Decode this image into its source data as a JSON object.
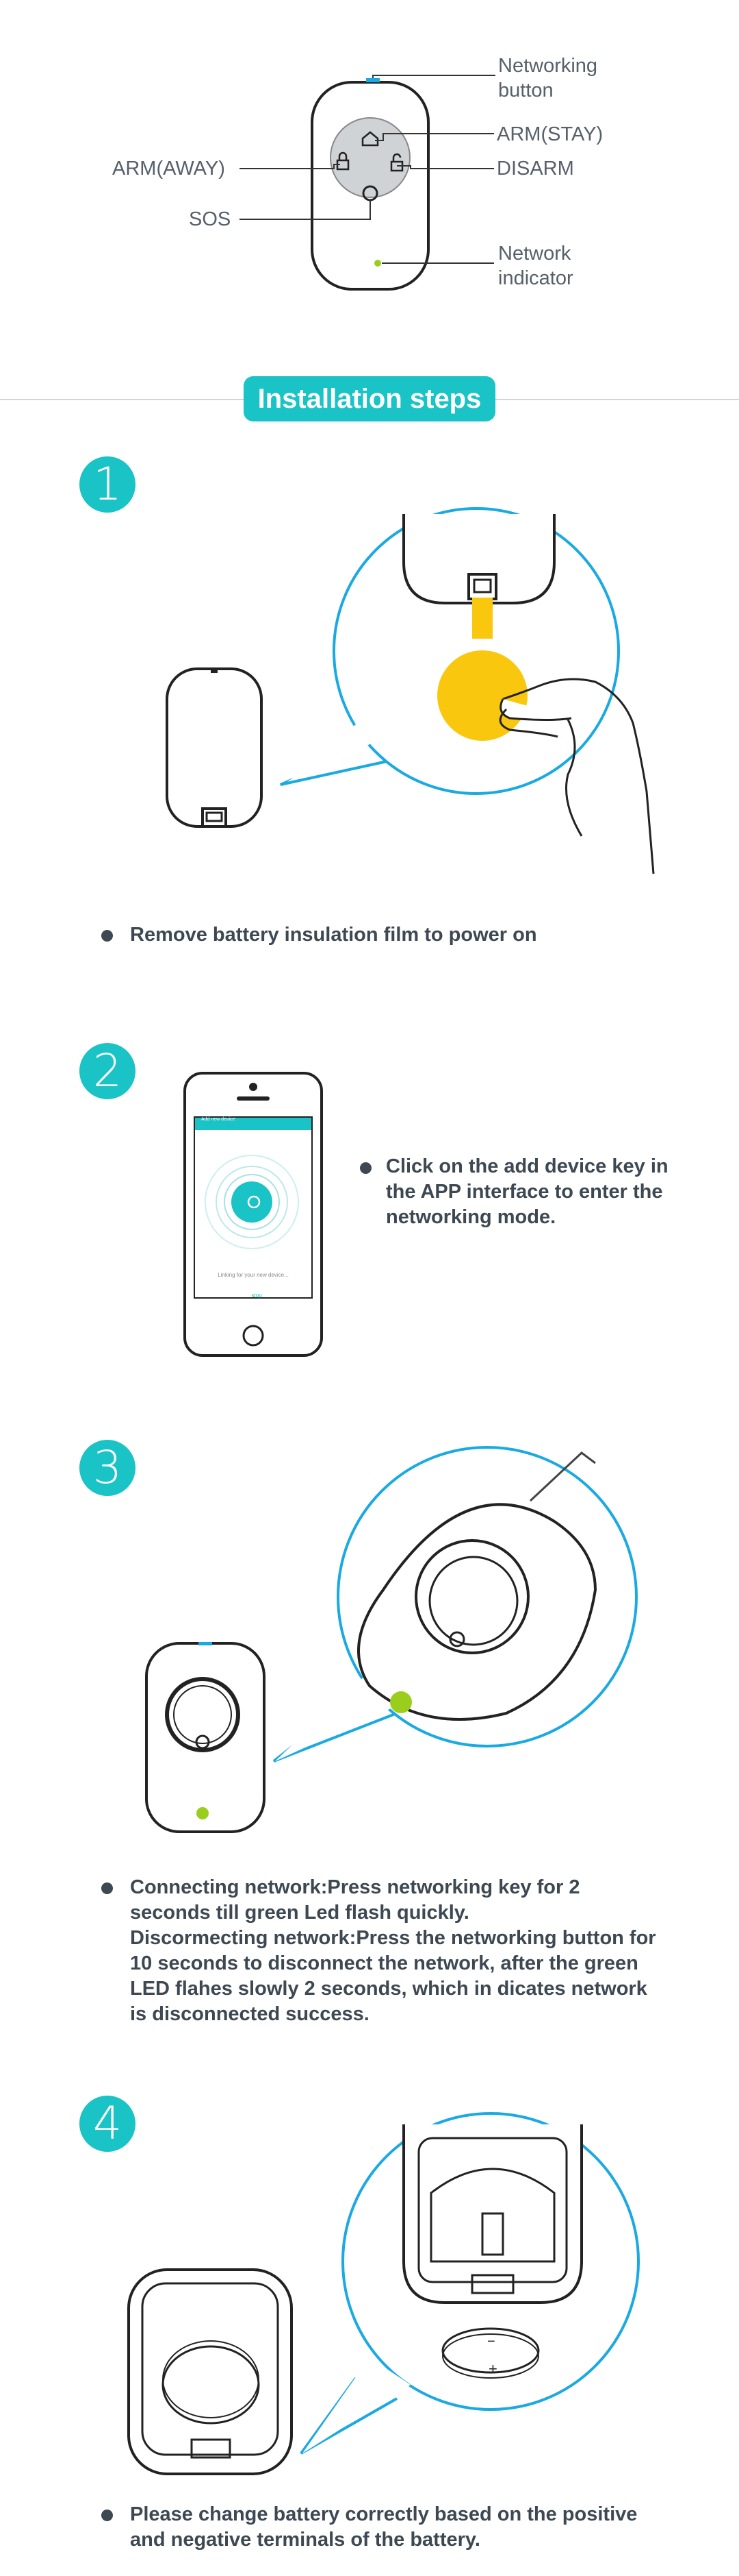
{
  "diagram": {
    "labels": {
      "networking_button": "Networking\nbutton",
      "arm_stay": "ARM(STAY)",
      "arm_away": "ARM(AWAY)",
      "disarm": "DISARM",
      "sos": "SOS",
      "network_indicator": "Network\nindicator"
    }
  },
  "section": {
    "title": "Installation steps"
  },
  "steps": [
    {
      "number": "1",
      "text": "Remove battery insulation film to power on"
    },
    {
      "number": "2",
      "text": "Click on the add device key in the APP interface to enter the networking mode."
    },
    {
      "number": "3",
      "text": "Connecting network:Press networking key for 2 seconds till green Led flash quickly.\nDiscormecting network:Press the networking button for 10 seconds to disconnect the network, after the green LED flahes slowly 2 seconds, which in dicates network is disconnected success."
    },
    {
      "number": "4",
      "text": "Please change battery correctly based on the positive and negative terminals of the battery."
    }
  ],
  "phone": {
    "header": "Add new device",
    "caption": "Linking for your new device...",
    "button": "stop"
  },
  "battery": {
    "minus": "−",
    "plus": "+"
  },
  "colors": {
    "accent": "#19c3c6",
    "bubble": "#1aa9e1",
    "yellow": "#f9c80e",
    "led": "#9acd1c"
  }
}
